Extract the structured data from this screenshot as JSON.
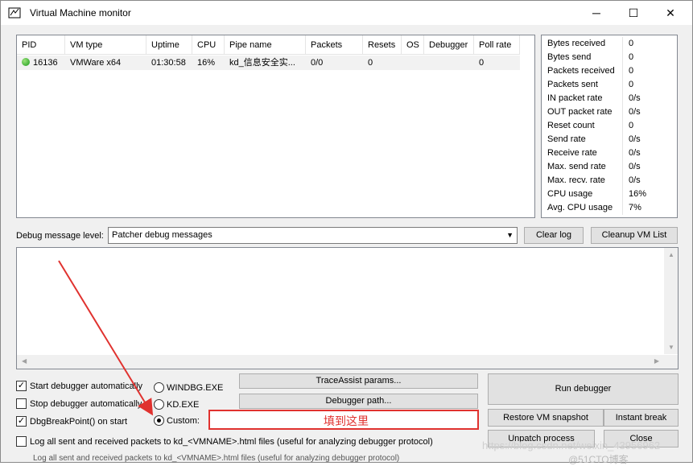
{
  "window": {
    "title": "Virtual Machine monitor",
    "controls": {
      "minimize": "─",
      "maximize": "☐",
      "close": "✕"
    }
  },
  "vm_table": {
    "columns": [
      "PID",
      "VM type",
      "Uptime",
      "CPU",
      "Pipe name",
      "Packets",
      "Resets",
      "OS",
      "Debugger",
      "Poll rate"
    ],
    "rows": [
      {
        "pid": "16136",
        "vm_type": "VMWare x64",
        "uptime": "01:30:58",
        "cpu": "16%",
        "pipe_name": "kd_信息安全实...",
        "packets": "0/0",
        "resets": "0",
        "os": "",
        "debugger": "",
        "poll_rate": "0",
        "status_color": "#1a9a1a"
      }
    ]
  },
  "stats": [
    {
      "label": "Bytes received",
      "value": "0"
    },
    {
      "label": "Bytes send",
      "value": "0"
    },
    {
      "label": "Packets received",
      "value": "0"
    },
    {
      "label": "Packets sent",
      "value": "0"
    },
    {
      "label": "IN packet rate",
      "value": "0/s"
    },
    {
      "label": "OUT packet rate",
      "value": "0/s"
    },
    {
      "label": "Reset count",
      "value": "0"
    },
    {
      "label": "Send rate",
      "value": "0/s"
    },
    {
      "label": "Receive rate",
      "value": "0/s"
    },
    {
      "label": "Max. send rate",
      "value": "0/s"
    },
    {
      "label": "Max. recv. rate",
      "value": "0/s"
    },
    {
      "label": "CPU usage",
      "value": "16%"
    },
    {
      "label": "Avg. CPU usage",
      "value": "7%"
    }
  ],
  "debug_level": {
    "label": "Debug message level:",
    "selected": "Patcher debug messages"
  },
  "buttons": {
    "clear_log": "Clear log",
    "cleanup_vm_list": "Cleanup VM List",
    "traceassist": "TraceAssist params...",
    "debugger_path": "Debugger path...",
    "run_debugger": "Run debugger",
    "restore_snapshot": "Restore VM snapshot",
    "instant_break": "Instant break",
    "unpatch_process": "Unpatch process",
    "close": "Close"
  },
  "options": {
    "start_auto": {
      "label": "Start debugger automatically",
      "checked": true
    },
    "stop_auto": {
      "label": "Stop debugger automatically",
      "checked": false
    },
    "dbg_break": {
      "label": "DbgBreakPoint() on start",
      "checked": true
    },
    "log_packets": {
      "label": "Log all sent and received packets to kd_<VMNAME>.html files (useful for analyzing debugger protocol)",
      "checked": false
    }
  },
  "debugger_choice": {
    "windbg": "WINDBG.EXE",
    "kd": "KD.EXE",
    "custom": "Custom:",
    "selected": "custom",
    "custom_value": ""
  },
  "annotation": {
    "text": "填到这里",
    "color": "#e0322f"
  },
  "background": {
    "strip_text": "Log all sent and received packets to kd_<VMNAME>.html files (useful for analyzing debugger protocol)",
    "watermark": "https://blog.csdn.net/weixin_43956962",
    "watermark2": "@51CTO博客"
  }
}
